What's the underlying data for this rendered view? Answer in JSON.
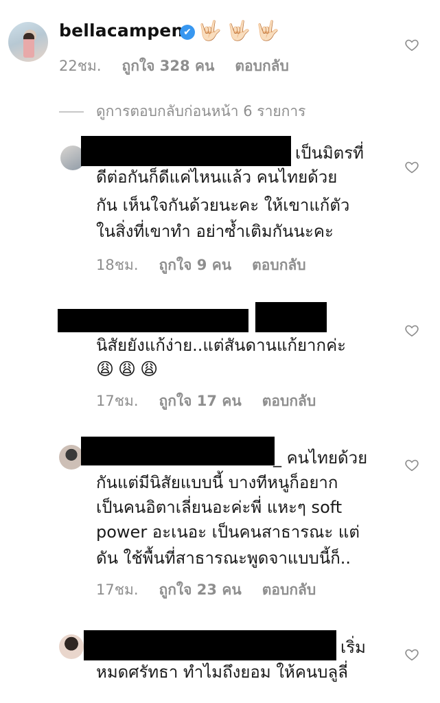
{
  "owner": {
    "username": "bellacampen",
    "verified_icon": "✔",
    "hands": [
      "🤟🏻",
      "🤟🏻",
      "🤟🏻"
    ],
    "time": "22ชม.",
    "likes": "ถูกใจ 328 คน",
    "reply": "ตอบกลับ"
  },
  "view_previous": "ดูการตอบกลับก่อนหน้า 6 รายการ",
  "replies": [
    {
      "lines": [
        "เป็นมิตรที่",
        "ดีต่อกันก็ดีแค่ไหนแล้ว คนไทยด้วย",
        "กัน เห็นใจกันด้วยนะคะ ให้เขาแก้ตัว",
        "ในสิ่งที่เขาทำ อย่าซ้ำเติมกันนะคะ"
      ],
      "time": "18ชม.",
      "likes": "ถูกใจ 9 คน",
      "reply": "ตอบกลับ"
    },
    {
      "lines": [
        "นิสัยยังแก้ง่าย..แต่สันดานแก้ยากค่ะ"
      ],
      "emojis": "😩😩😩",
      "time": "17ชม.",
      "likes": "ถูกใจ 17 คน",
      "reply": "ตอบกลับ"
    },
    {
      "lines": [
        "_ คนไทยด้วย",
        "กันแต่มีนิสัยแบบนี้ บางทีหนูก็อยาก",
        "เป็นคนอิตาเลี่ยนอะค่ะพี่ แหะๆ soft",
        "power อะเนอะ เป็นคนสาธารณะ แต่",
        "ดัน ใช้พื้นที่สาธารณะพูดจาแบบนี้ก็.."
      ],
      "time": "17ชม.",
      "likes": "ถูกใจ 23 คน",
      "reply": "ตอบกลับ"
    },
    {
      "lines": [
        "เริ่ม",
        "หมดศรัทธา ทำไมถึงยอม ให้คนบลูลี่"
      ]
    }
  ],
  "icons": {
    "heart": "heart-outline-icon"
  }
}
